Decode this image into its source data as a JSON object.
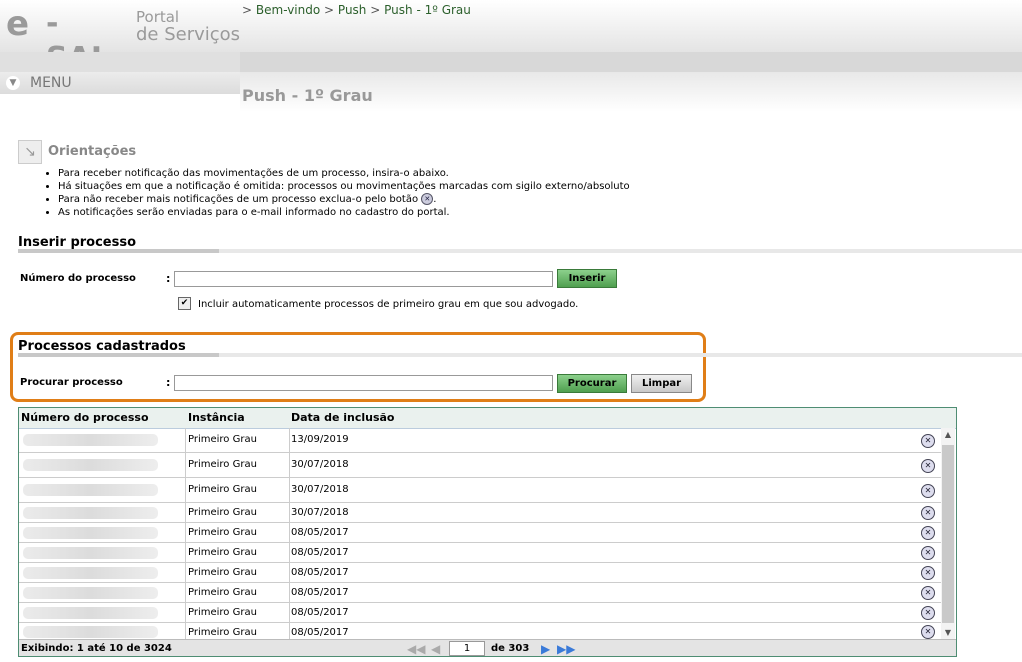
{
  "header": {
    "logo_e": "e",
    "logo_saj": "-SAJ",
    "logo_portal": "Portal",
    "logo_servicos": "de Serviços"
  },
  "breadcrumb": {
    "sep": ">",
    "items": [
      "Bem-vindo",
      "Push",
      "Push - 1º Grau"
    ]
  },
  "menu": {
    "label": "MENU"
  },
  "page_title": "Push - 1º Grau",
  "orientacoes": {
    "title": "Orientações",
    "items": [
      "Para receber notificação das movimentações de um processo, insira-o abaixo.",
      "Há situações em que a notificação é omitida: processos ou movimentações marcadas com sigilo externo/absoluto",
      "Para não receber mais notificações de um processo exclua-o pelo botão",
      "As notificações serão enviadas para o e-mail informado no cadastro do portal."
    ]
  },
  "inserir": {
    "title": "Inserir processo",
    "field_label": "Número do processo",
    "colon": ":",
    "input_value": "",
    "button": "Inserir",
    "checkbox_checked": true,
    "checkbox_label": "Incluir automaticamente processos de primeiro grau em que sou advogado."
  },
  "cadastrados": {
    "title": "Processos cadastrados",
    "search_label": "Procurar processo",
    "colon": ":",
    "search_value": "",
    "search_button": "Procurar",
    "clear_button": "Limpar"
  },
  "table": {
    "columns": [
      "Número do processo",
      "Instância",
      "Data de inclusão"
    ],
    "rows": [
      {
        "instancia": "Primeiro Grau",
        "data": "13/09/2019"
      },
      {
        "instancia": "Primeiro Grau",
        "data": "30/07/2018"
      },
      {
        "instancia": "Primeiro Grau",
        "data": "30/07/2018"
      },
      {
        "instancia": "Primeiro Grau",
        "data": "30/07/2018"
      },
      {
        "instancia": "Primeiro Grau",
        "data": "08/05/2017"
      },
      {
        "instancia": "Primeiro Grau",
        "data": "08/05/2017"
      },
      {
        "instancia": "Primeiro Grau",
        "data": "08/05/2017"
      },
      {
        "instancia": "Primeiro Grau",
        "data": "08/05/2017"
      },
      {
        "instancia": "Primeiro Grau",
        "data": "08/05/2017"
      },
      {
        "instancia": "Primeiro Grau",
        "data": "08/05/2017"
      }
    ],
    "footer": {
      "exibindo": "Exibindo: 1 até 10 de 3024",
      "page": "1",
      "of_pages": "de 303"
    }
  }
}
